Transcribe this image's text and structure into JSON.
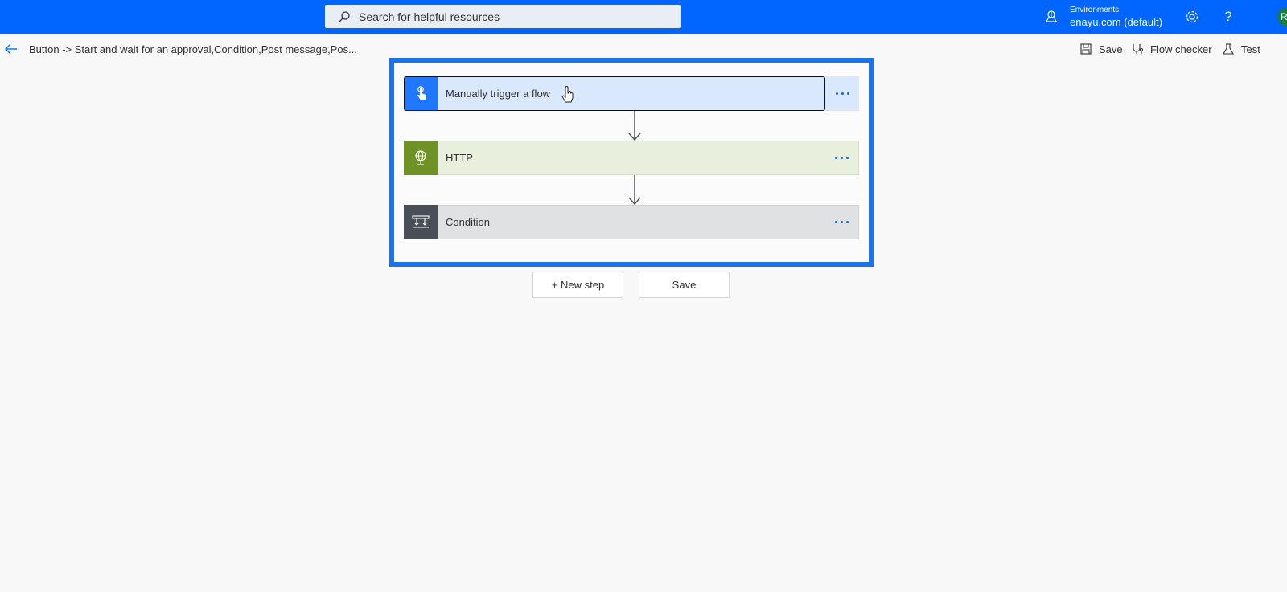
{
  "colors": {
    "topbar": "#0066ff",
    "frame": "#1a73e8",
    "trigger_icon": "#1f78ff",
    "trigger_bg": "#d9e8fd",
    "http_icon": "#6f9226",
    "http_bg": "#e8efdd",
    "condition_icon": "#484f58",
    "condition_bg": "#dfe1e2"
  },
  "topbar": {
    "search_placeholder": "Search for helpful resources",
    "search_icon": "search-icon",
    "environment_label": "Environments",
    "environment_name": "enayu.com (default)",
    "settings_icon": "gear-icon",
    "help_icon": "question-icon",
    "help_glyph": "?",
    "avatar_initial": "R"
  },
  "commandbar": {
    "breadcrumb": "Button -> Start and wait for an approval,Condition,Post message,Pos...",
    "save_label": "Save",
    "flow_checker_label": "Flow checker",
    "test_label": "Test"
  },
  "flow": {
    "steps": [
      {
        "label": "Manually trigger a flow",
        "icon": "touch-hand-icon"
      },
      {
        "label": "HTTP",
        "icon": "globe-icon"
      },
      {
        "label": "Condition",
        "icon": "condition-icon"
      }
    ],
    "new_step_label": "+ New step",
    "save_label": "Save"
  }
}
